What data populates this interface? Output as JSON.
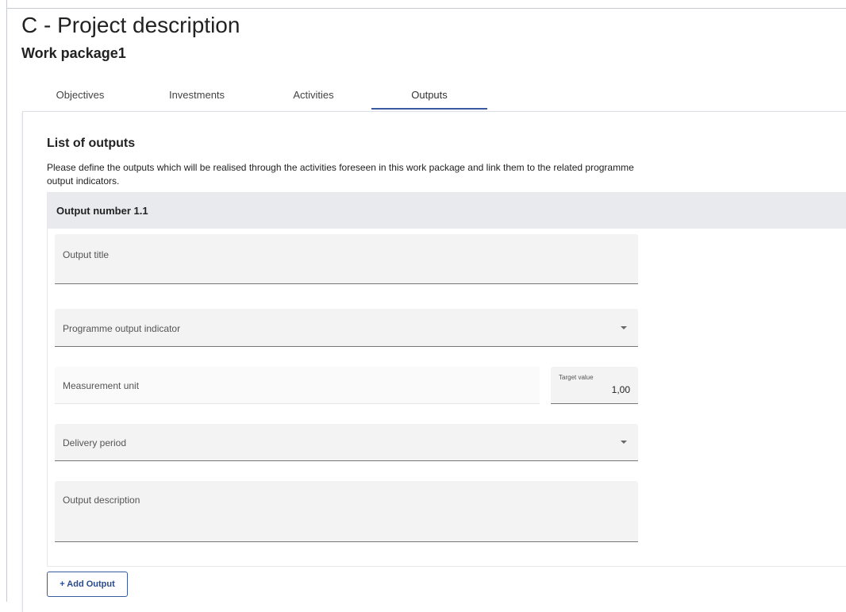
{
  "page": {
    "title": "C - Project description",
    "subtitle": "Work package1"
  },
  "tabs": [
    {
      "label": "Objectives",
      "active": false
    },
    {
      "label": "Investments",
      "active": false
    },
    {
      "label": "Activities",
      "active": false
    },
    {
      "label": "Outputs",
      "active": true
    }
  ],
  "section": {
    "title": "List of outputs",
    "description": "Please define the outputs which will be realised through the activities foreseen in this work package and link them to the related programme output indicators."
  },
  "output": {
    "header": "Output number 1.1",
    "fields": {
      "output_title": {
        "label": "Output title",
        "value": ""
      },
      "programme_output_indicator": {
        "label": "Programme output indicator",
        "value": ""
      },
      "measurement_unit": {
        "label": "Measurement unit",
        "value": ""
      },
      "target_value": {
        "label": "Target value",
        "value": "1,00"
      },
      "delivery_period": {
        "label": "Delivery period",
        "value": ""
      },
      "output_description": {
        "label": "Output description",
        "value": ""
      }
    }
  },
  "actions": {
    "add_output_label": "+ Add Output"
  },
  "colors": {
    "accent": "#3a5a9f",
    "field_bg": "#f3f3f3",
    "header_bg": "#e8eaed"
  }
}
